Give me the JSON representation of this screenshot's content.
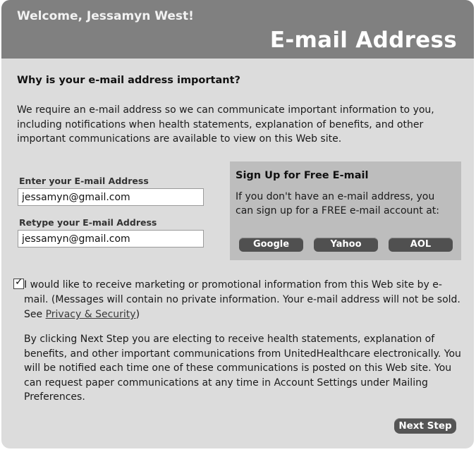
{
  "header": {
    "welcome": "Welcome, Jessamyn West!",
    "title": "E-mail Address"
  },
  "intro": {
    "heading": "Why is your e-mail address important?",
    "body": "We require an e-mail address so we can communicate important information to you, including notifications when health statements, explanation of benefits, and other important communications are available to view on this Web site."
  },
  "form": {
    "email_label": "Enter your E-mail Address",
    "email_value": "jessamyn@gmail.com",
    "retype_label": "Retype your E-mail Address",
    "retype_value": "jessamyn@gmail.com"
  },
  "signup": {
    "title": "Sign Up for Free E-mail",
    "text": "If you don't have an e-mail address, you can sign up for a FREE e-mail account at:",
    "buttons": [
      "Google",
      "Yahoo",
      "AOL"
    ]
  },
  "optin": {
    "checked": true,
    "text_before": "I would like to receive marketing or promotional information from this Web site by e-mail. (Messages will contain no private information. Your e-mail address will not be sold. See ",
    "link": "Privacy & Security",
    "text_after": ")"
  },
  "disclaimer": "By clicking Next Step you are electing to receive health statements, explanation of benefits, and other important communications from UnitedHealthcare electronically. You will be notified each time one of these communications is posted on this Web site. You can request paper communications at any time in Account Settings under Mailing Preferences.",
  "actions": {
    "next_label": "Next Step"
  }
}
